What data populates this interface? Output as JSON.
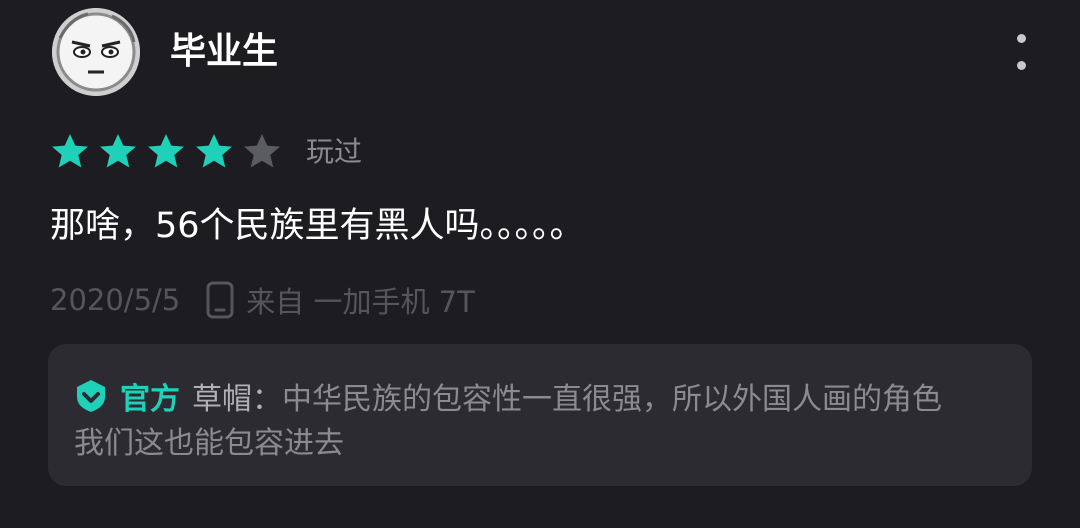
{
  "user": {
    "name": "毕业生"
  },
  "rating": {
    "stars": 4,
    "max": 5,
    "status": "玩过"
  },
  "review": {
    "text": "那啥，56个民族里有黑人吗。。。。。"
  },
  "meta": {
    "date": "2020/5/5",
    "device_text": "来自 一加手机 7T"
  },
  "reply": {
    "official_label": "官方",
    "author": "草帽：",
    "text_line1": "中华民族的包容性一直很强，所以外国人画的角色",
    "text_line2": "我们这也能包容进去"
  },
  "colors": {
    "accent": "#1fd1b8",
    "star_empty": "#5b5b62",
    "background": "#1c1c21",
    "reply_background": "#2b2b31"
  },
  "icons": {
    "avatar": "cartoon-face-avatar",
    "more": "more-vertical-icon",
    "device": "phone-icon",
    "official": "verified-shield-icon"
  }
}
